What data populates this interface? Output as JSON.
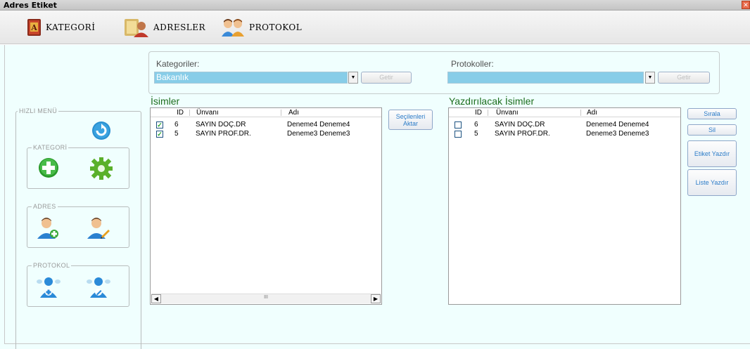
{
  "window": {
    "title": "Adres Etiket",
    "close_glyph": "✕"
  },
  "menu": {
    "items": [
      {
        "label": "KATEGORİ",
        "icon": "address-book-icon"
      },
      {
        "label": "ADRESLER",
        "icon": "contacts-folder-icon"
      },
      {
        "label": "PROTOKOL",
        "icon": "people-icon"
      }
    ]
  },
  "filters": {
    "kategori_label": "Kategoriler:",
    "kategori_value": "Bakanlık",
    "protokol_label": "Protokoller:",
    "protokol_value": "",
    "getir_label": "Getir",
    "dropdown_glyph": "▼"
  },
  "isimler": {
    "title": "İsimler",
    "columns": [
      "ID",
      "Ünvanı",
      "Adı"
    ],
    "rows": [
      {
        "checked": true,
        "checkmark": "✓",
        "id": "6",
        "unvan": "SAYIN DOÇ.DR",
        "adi": "Deneme4 Deneme4"
      },
      {
        "checked": true,
        "checkmark": "✓",
        "id": "5",
        "unvan": "SAYIN PROF.DR.",
        "adi": "Deneme3 Deneme3"
      }
    ],
    "scroll_left": "◀",
    "scroll_right": "▶",
    "scroll_grip": "III"
  },
  "aktar_button": "Seçilenleri Aktar",
  "yazdirilacak": {
    "title": "Yazdırılacak İsimler",
    "columns": [
      "ID",
      "Ünvanı",
      "Adı"
    ],
    "rows": [
      {
        "checked": false,
        "id": "6",
        "unvan": "SAYIN DOÇ.DR",
        "adi": "Deneme4 Deneme4"
      },
      {
        "checked": false,
        "id": "5",
        "unvan": "SAYIN PROF.DR.",
        "adi": "Deneme3 Deneme3"
      }
    ]
  },
  "right_buttons": {
    "sirala": "Sırala",
    "sil": "Sil",
    "etiket_yazdir": "Etiket Yazdır",
    "liste_yazdir": "Liste Yazdır"
  },
  "hizli_menu": {
    "title": "HIZLI MENÜ",
    "refresh_icon": "refresh-icon",
    "kategori": {
      "title": "KATEGORİ",
      "icons": [
        "add-icon",
        "settings-gear-icon"
      ]
    },
    "adres": {
      "title": "ADRES",
      "icons": [
        "add-user-icon",
        "edit-user-icon"
      ]
    },
    "protokol": {
      "title": "PROTOKOL",
      "icons": [
        "add-protocol-user-icon",
        "edit-protocol-user-icon"
      ]
    }
  }
}
